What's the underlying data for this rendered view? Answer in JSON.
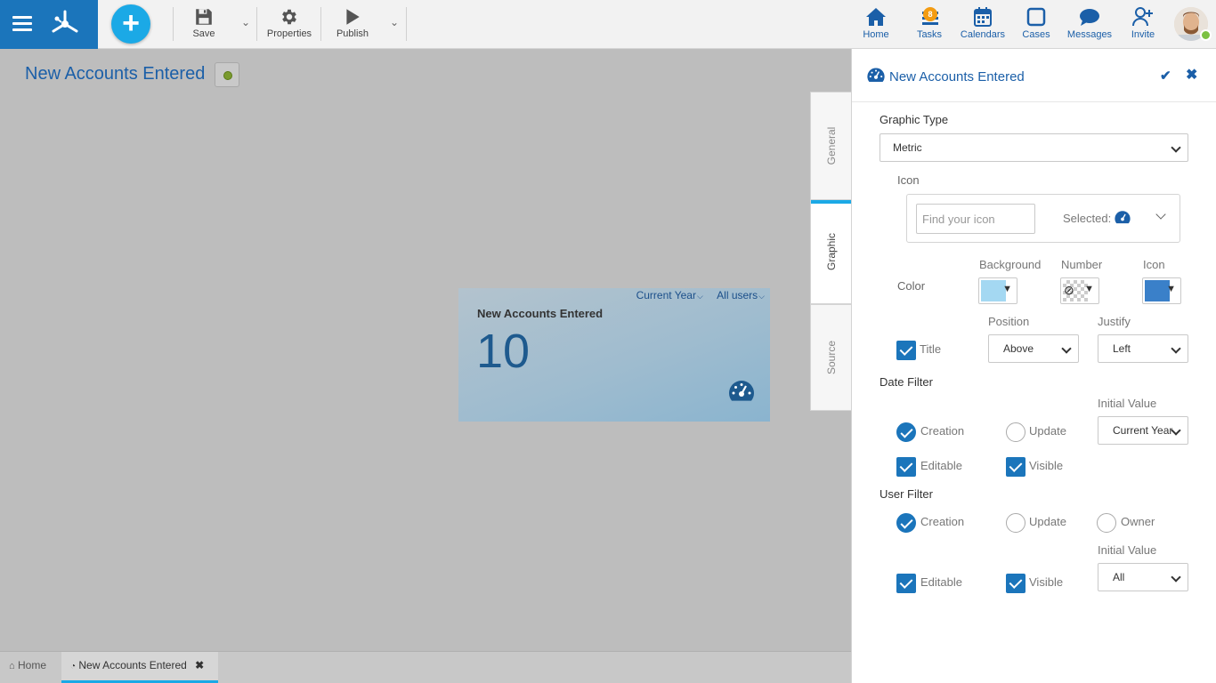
{
  "toolbar": {
    "save_label": "Save",
    "properties_label": "Properties",
    "publish_label": "Publish",
    "add_symbol": "+"
  },
  "nav": {
    "home": "Home",
    "tasks": "Tasks",
    "tasks_badge": "8",
    "calendars": "Calendars",
    "cases": "Cases",
    "messages": "Messages",
    "invite": "Invite"
  },
  "page": {
    "title": "New Accounts Entered",
    "status_color": "#7a9a2e"
  },
  "widget": {
    "date_filter": "Current Year",
    "user_filter": "All users",
    "title": "New Accounts Entered",
    "value": "10",
    "icon": "dashboard-gauge-icon"
  },
  "side_tabs": [
    "General",
    "Graphic",
    "Source"
  ],
  "panel": {
    "title": "New Accounts Entered",
    "graphic_type_label": "Graphic Type",
    "graphic_type_value": "Metric",
    "icon_label": "Icon",
    "find_placeholder": "Find your icon",
    "selected_label": "Selected:",
    "color_label": "Color",
    "background_label": "Background",
    "number_label": "Number",
    "icon_color_label": "Icon",
    "background_color": "#a4d8f2",
    "icon_color": "#3a80c9",
    "position_label": "Position",
    "justify_label": "Justify",
    "title_check_label": "Title",
    "position_value": "Above",
    "justify_value": "Left",
    "date_filter_label": "Date Filter",
    "initial_value_label": "Initial Value",
    "date_creation": "Creation",
    "date_update": "Update",
    "date_initial_value": "Current Year",
    "date_editable": "Editable",
    "date_visible": "Visible",
    "user_filter_label": "User Filter",
    "user_creation": "Creation",
    "user_update": "Update",
    "user_owner": "Owner",
    "user_initial_value_label": "Initial Value",
    "user_initial_value": "All",
    "user_editable": "Editable",
    "user_visible": "Visible"
  },
  "bottom_tabs": {
    "home": "Home",
    "current": "New Accounts Entered"
  }
}
